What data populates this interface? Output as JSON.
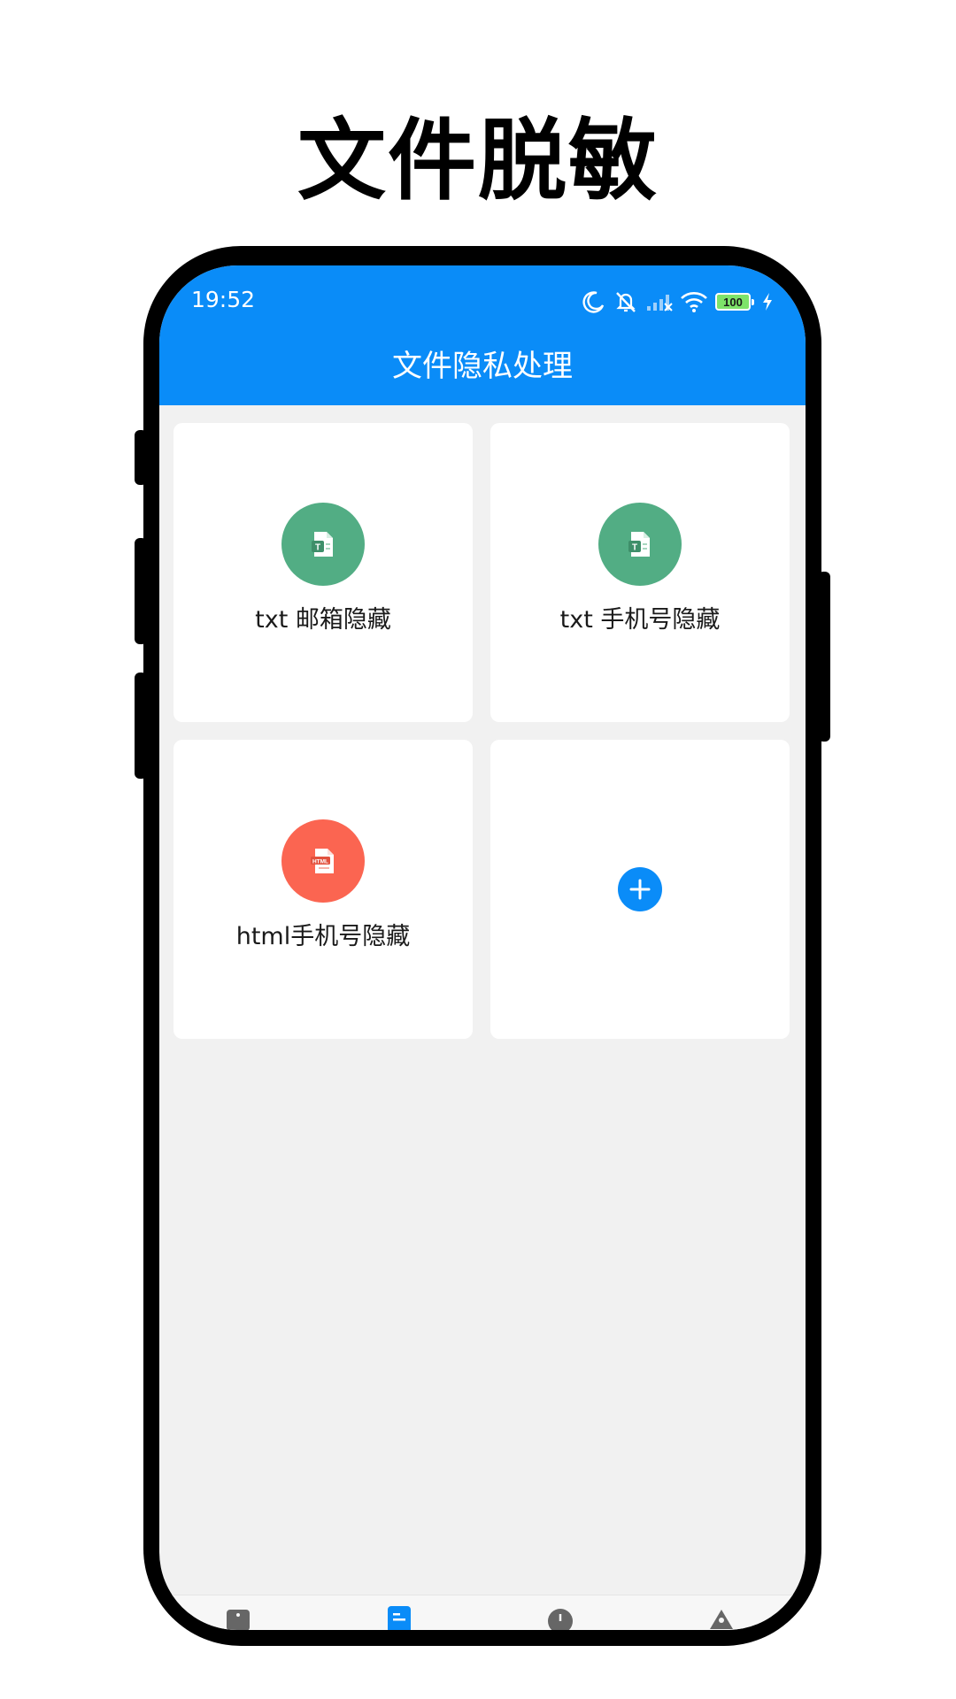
{
  "promo": {
    "title": "文件脱敏"
  },
  "status_bar": {
    "time": "19:52",
    "battery": "100",
    "icons": [
      "moon-icon",
      "mute-icon",
      "signal-icon",
      "wifi-icon",
      "battery-icon",
      "charging-icon"
    ]
  },
  "app_bar": {
    "title": "文件隐私处理"
  },
  "cards": [
    {
      "label": "txt 邮箱隐藏",
      "icon": "txt-file-icon",
      "color": "#52ad84"
    },
    {
      "label": "txt 手机号隐藏",
      "icon": "txt-file-icon",
      "color": "#52ad84"
    },
    {
      "label": "html手机号隐藏",
      "icon": "html-file-icon",
      "color": "#fb6551"
    },
    {
      "label": "",
      "icon": "plus-icon",
      "color": "#0a8cf8"
    }
  ],
  "bottom_nav": {
    "items": [
      "tools-icon",
      "documents-icon",
      "history-icon",
      "profile-icon"
    ],
    "active": 1
  },
  "colors": {
    "accent": "#0a8cf8",
    "background": "#f1f1f1",
    "card": "#ffffff"
  }
}
